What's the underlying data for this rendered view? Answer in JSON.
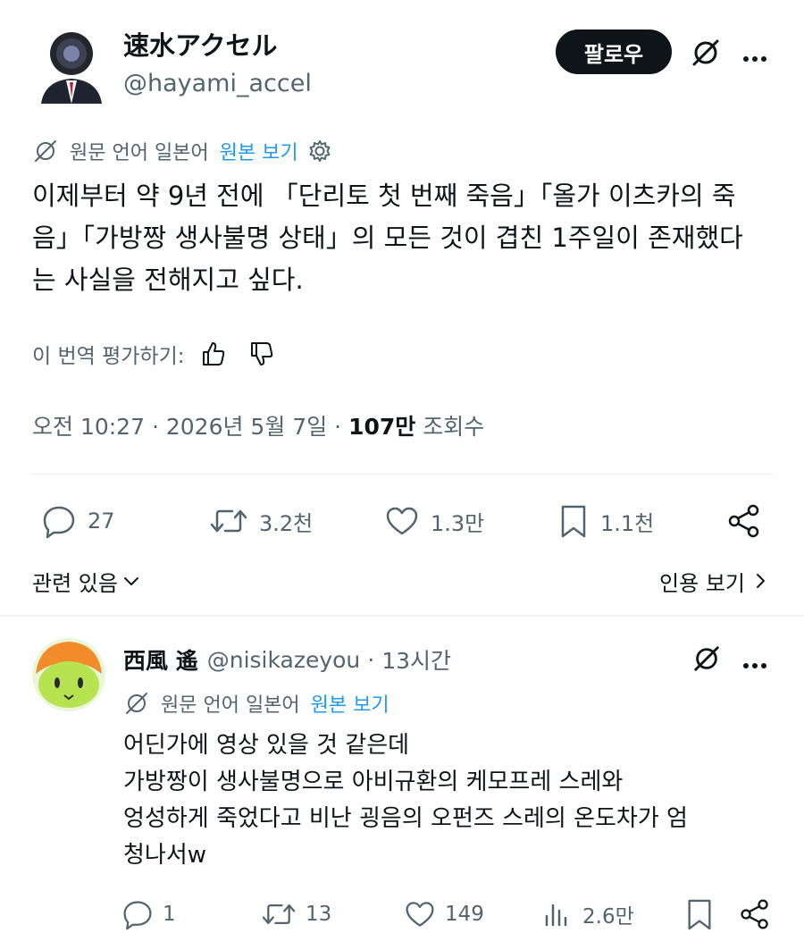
{
  "tweet": {
    "author": {
      "display_name": "速水アクセル",
      "handle": "@hayami_accel"
    },
    "follow_label": "팔로우",
    "translation_notice": {
      "prefix": "원문 언어 일본어",
      "link": "원본 보기"
    },
    "body": "이제부터 약 9년 전에 「단리토 첫 번째 죽음」「올가 이츠카의 죽음」「가방짱 생사불명 상태」의 모든 것이 겹친 1주일이 존재했다는 사실을 전해지고 싶다.",
    "rate_label": "이 번역 평가하기:",
    "meta": {
      "time": "오전 10:27",
      "date": "2026년 5월 7일",
      "views": "107만",
      "views_label": "조회수"
    },
    "actions": {
      "replies": "27",
      "reposts": "3.2천",
      "likes": "1.3만",
      "bookmarks": "1.1천"
    },
    "related_label": "관련 있음",
    "quotes_label": "인용 보기"
  },
  "reply": {
    "author": {
      "display_name": "西風 遙",
      "handle": "@nisikazeyou"
    },
    "age": "13시간",
    "translation_notice": {
      "prefix": "원문 언어 일본어",
      "link": "원본 보기"
    },
    "body_lines": [
      "어딘가에 영상 있을 것 같은데",
      "가방짱이 생사불명으로 아비규환의 케모프레 스레와",
      "엉성하게 죽었다고 비난 굉음의 오펀즈 스레의 온도차가 엄",
      "청나서w"
    ],
    "actions": {
      "replies": "1",
      "reposts": "13",
      "likes": "149",
      "views": "2.6만"
    }
  },
  "colors": {
    "text": "#0f1419",
    "secondary": "#536471",
    "link": "#1d9bf0",
    "follow_bg": "#0f1419",
    "divider": "#eff3f4"
  },
  "icons": [
    "grok-icon",
    "more-icon",
    "translate-icon",
    "settings-gear-icon",
    "thumbs-up-icon",
    "thumbs-down-icon",
    "reply-icon",
    "repost-icon",
    "like-icon",
    "bookmark-icon",
    "share-icon",
    "chevron-down-icon",
    "chevron-right-icon",
    "views-chart-icon"
  ]
}
